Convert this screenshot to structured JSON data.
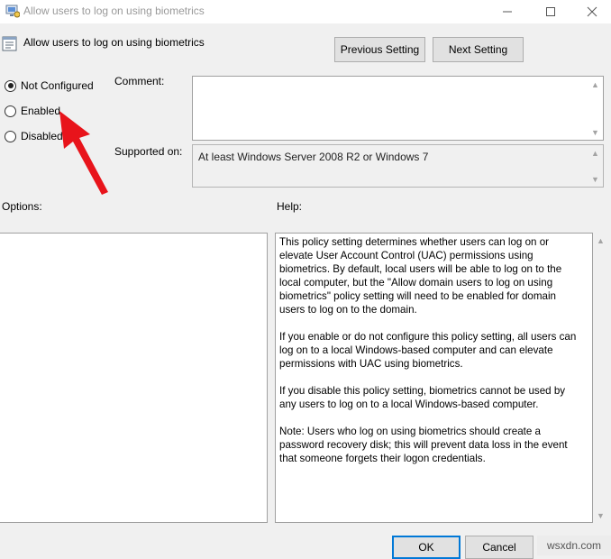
{
  "window": {
    "title": "Allow users to log on using biometrics",
    "controls": [
      "minimize",
      "maximize",
      "close"
    ]
  },
  "header": {
    "title": "Allow users to log on using biometrics",
    "previous_label": "Previous Setting",
    "next_label": "Next Setting"
  },
  "state": {
    "options": [
      {
        "label": "Not Configured",
        "checked": true
      },
      {
        "label": "Enabled",
        "checked": false
      },
      {
        "label": "Disabled",
        "checked": false
      }
    ]
  },
  "comment": {
    "label": "Comment:",
    "value": ""
  },
  "supported": {
    "label": "Supported on:",
    "value": "At least Windows Server 2008 R2 or Windows 7"
  },
  "options_panel": {
    "label": "Options:"
  },
  "help": {
    "label": "Help:",
    "paragraphs": [
      "This policy setting determines whether users can log on or elevate User Account Control (UAC) permissions using biometrics.  By default, local users will be able to log on to the local computer, but the \"Allow domain users to log on using biometrics\" policy setting will need to be enabled for domain users to log on to the domain.",
      "If you enable or do not configure this policy setting, all users can log on to a local Windows-based computer and can elevate permissions with UAC using biometrics.",
      "If you disable this policy setting, biometrics cannot be used by any users to log on to a local Windows-based computer.",
      "Note: Users who log on using biometrics should create a password recovery disk; this will prevent data loss in the event that someone forgets their logon credentials."
    ]
  },
  "footer": {
    "ok_label": "OK",
    "cancel_label": "Cancel"
  },
  "watermark": "wsxdn.com",
  "annotation": {
    "color": "#e8141b"
  },
  "icons": [
    "app-icon",
    "policy-icon",
    "minimize-icon",
    "maximize-icon",
    "close-icon",
    "scroll-up-icon",
    "scroll-down-icon",
    "red-arrow-icon"
  ]
}
